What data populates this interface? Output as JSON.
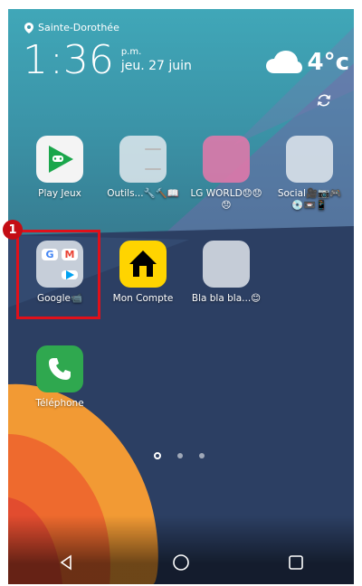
{
  "status": {
    "location": "Sainte-Dorothée",
    "time_hour": "1",
    "time_min": ":36",
    "ampm": "p.m.",
    "date": "jeu. 27 juin",
    "temperature": "4°c"
  },
  "apps_row1": [
    {
      "label": "Play Jeux",
      "icon": "play-games-icon"
    },
    {
      "label": "Outils...🔧🔨📖",
      "icon": "tools-folder-icon"
    },
    {
      "label": "LG WORLD😞😞\n😞",
      "icon": "lg-world-folder-icon"
    },
    {
      "label": "Social🎥📷🎮\n💿📼📱",
      "icon": "social-folder-icon"
    }
  ],
  "apps_row2": [
    {
      "label": "Google📹",
      "icon": "google-folder-icon"
    },
    {
      "label": "Mon Compte",
      "icon": "mon-compte-icon"
    },
    {
      "label": "Bla bla bla...😊",
      "icon": "bla-bla-folder-icon"
    }
  ],
  "apps_row3": [
    {
      "label": "Téléphone",
      "icon": "phone-icon"
    }
  ],
  "annotation": {
    "badge": "1"
  },
  "colors": {
    "highlight": "#e0101a",
    "badge": "#c40d14",
    "play_green": "#1aa64b",
    "phone_green": "#2fa84f",
    "mon_compte_yellow": "#ffd400"
  }
}
